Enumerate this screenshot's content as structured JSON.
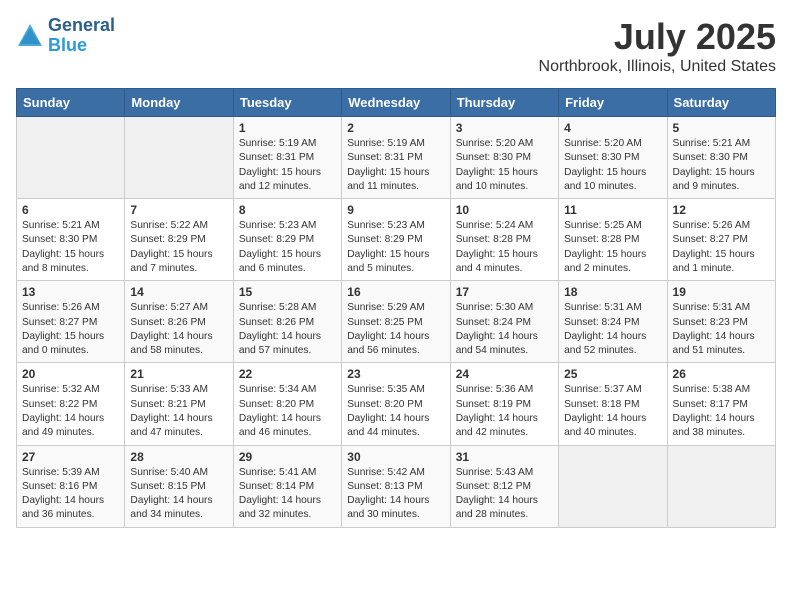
{
  "header": {
    "logo": {
      "general": "General",
      "blue": "Blue"
    },
    "title": "July 2025",
    "location": "Northbrook, Illinois, United States"
  },
  "calendar": {
    "days": [
      "Sunday",
      "Monday",
      "Tuesday",
      "Wednesday",
      "Thursday",
      "Friday",
      "Saturday"
    ],
    "weeks": [
      [
        {
          "day": "",
          "content": ""
        },
        {
          "day": "",
          "content": ""
        },
        {
          "day": "1",
          "content": "Sunrise: 5:19 AM\nSunset: 8:31 PM\nDaylight: 15 hours and 12 minutes."
        },
        {
          "day": "2",
          "content": "Sunrise: 5:19 AM\nSunset: 8:31 PM\nDaylight: 15 hours and 11 minutes."
        },
        {
          "day": "3",
          "content": "Sunrise: 5:20 AM\nSunset: 8:30 PM\nDaylight: 15 hours and 10 minutes."
        },
        {
          "day": "4",
          "content": "Sunrise: 5:20 AM\nSunset: 8:30 PM\nDaylight: 15 hours and 10 minutes."
        },
        {
          "day": "5",
          "content": "Sunrise: 5:21 AM\nSunset: 8:30 PM\nDaylight: 15 hours and 9 minutes."
        }
      ],
      [
        {
          "day": "6",
          "content": "Sunrise: 5:21 AM\nSunset: 8:30 PM\nDaylight: 15 hours and 8 minutes."
        },
        {
          "day": "7",
          "content": "Sunrise: 5:22 AM\nSunset: 8:29 PM\nDaylight: 15 hours and 7 minutes."
        },
        {
          "day": "8",
          "content": "Sunrise: 5:23 AM\nSunset: 8:29 PM\nDaylight: 15 hours and 6 minutes."
        },
        {
          "day": "9",
          "content": "Sunrise: 5:23 AM\nSunset: 8:29 PM\nDaylight: 15 hours and 5 minutes."
        },
        {
          "day": "10",
          "content": "Sunrise: 5:24 AM\nSunset: 8:28 PM\nDaylight: 15 hours and 4 minutes."
        },
        {
          "day": "11",
          "content": "Sunrise: 5:25 AM\nSunset: 8:28 PM\nDaylight: 15 hours and 2 minutes."
        },
        {
          "day": "12",
          "content": "Sunrise: 5:26 AM\nSunset: 8:27 PM\nDaylight: 15 hours and 1 minute."
        }
      ],
      [
        {
          "day": "13",
          "content": "Sunrise: 5:26 AM\nSunset: 8:27 PM\nDaylight: 15 hours and 0 minutes."
        },
        {
          "day": "14",
          "content": "Sunrise: 5:27 AM\nSunset: 8:26 PM\nDaylight: 14 hours and 58 minutes."
        },
        {
          "day": "15",
          "content": "Sunrise: 5:28 AM\nSunset: 8:26 PM\nDaylight: 14 hours and 57 minutes."
        },
        {
          "day": "16",
          "content": "Sunrise: 5:29 AM\nSunset: 8:25 PM\nDaylight: 14 hours and 56 minutes."
        },
        {
          "day": "17",
          "content": "Sunrise: 5:30 AM\nSunset: 8:24 PM\nDaylight: 14 hours and 54 minutes."
        },
        {
          "day": "18",
          "content": "Sunrise: 5:31 AM\nSunset: 8:24 PM\nDaylight: 14 hours and 52 minutes."
        },
        {
          "day": "19",
          "content": "Sunrise: 5:31 AM\nSunset: 8:23 PM\nDaylight: 14 hours and 51 minutes."
        }
      ],
      [
        {
          "day": "20",
          "content": "Sunrise: 5:32 AM\nSunset: 8:22 PM\nDaylight: 14 hours and 49 minutes."
        },
        {
          "day": "21",
          "content": "Sunrise: 5:33 AM\nSunset: 8:21 PM\nDaylight: 14 hours and 47 minutes."
        },
        {
          "day": "22",
          "content": "Sunrise: 5:34 AM\nSunset: 8:20 PM\nDaylight: 14 hours and 46 minutes."
        },
        {
          "day": "23",
          "content": "Sunrise: 5:35 AM\nSunset: 8:20 PM\nDaylight: 14 hours and 44 minutes."
        },
        {
          "day": "24",
          "content": "Sunrise: 5:36 AM\nSunset: 8:19 PM\nDaylight: 14 hours and 42 minutes."
        },
        {
          "day": "25",
          "content": "Sunrise: 5:37 AM\nSunset: 8:18 PM\nDaylight: 14 hours and 40 minutes."
        },
        {
          "day": "26",
          "content": "Sunrise: 5:38 AM\nSunset: 8:17 PM\nDaylight: 14 hours and 38 minutes."
        }
      ],
      [
        {
          "day": "27",
          "content": "Sunrise: 5:39 AM\nSunset: 8:16 PM\nDaylight: 14 hours and 36 minutes."
        },
        {
          "day": "28",
          "content": "Sunrise: 5:40 AM\nSunset: 8:15 PM\nDaylight: 14 hours and 34 minutes."
        },
        {
          "day": "29",
          "content": "Sunrise: 5:41 AM\nSunset: 8:14 PM\nDaylight: 14 hours and 32 minutes."
        },
        {
          "day": "30",
          "content": "Sunrise: 5:42 AM\nSunset: 8:13 PM\nDaylight: 14 hours and 30 minutes."
        },
        {
          "day": "31",
          "content": "Sunrise: 5:43 AM\nSunset: 8:12 PM\nDaylight: 14 hours and 28 minutes."
        },
        {
          "day": "",
          "content": ""
        },
        {
          "day": "",
          "content": ""
        }
      ]
    ]
  }
}
